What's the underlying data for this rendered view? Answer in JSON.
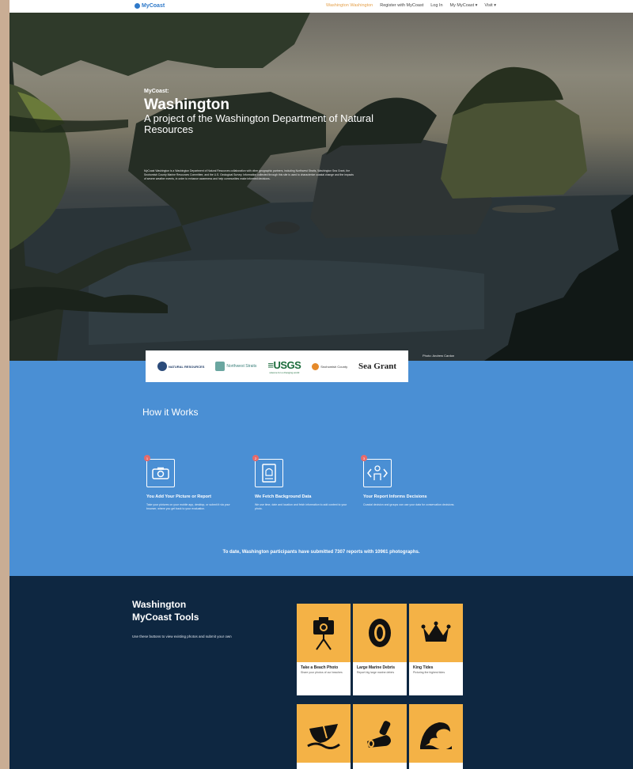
{
  "nav": {
    "brand": "MyCoast",
    "links": [
      "Washington Washington",
      "Register with MyCoast",
      "Log In",
      "My MyCoast ▾",
      "Visit ▾"
    ]
  },
  "hero": {
    "kicker": "MyCoast:",
    "title": "Washington",
    "subtitle": "A project of the Washington Department of Natural Resources",
    "description": "MyCoast Washington is a Washington Department of Natural Resources collaboration with other geographic partners, including Northwest Straits, Washington Sea Grant, the Snohomish County Marine Resources Committee, and the U.S. Geological Survey. Information collected through this site is used to characterize coastal change and the impacts of severe weather events, in order to enhance awareness and help communities make informed decisions.",
    "credit": "Photo: Andrew Cardon"
  },
  "logos": {
    "dnr": "NATURAL RESOURCES",
    "nws": "Northwest Straits",
    "usgs": "≡USGS",
    "usgs_tag": "science for a changing world",
    "snoco": "Snohomish County",
    "seagrant": "Sea Grant"
  },
  "how": {
    "title": "How it Works",
    "steps": [
      {
        "num": "1",
        "icon": "camera-icon",
        "title": "You Add Your Picture or Report",
        "desc": "Take your pictures on your mobile app, desktop, or submit it via your browser, where you get back to your evaluation."
      },
      {
        "num": "2",
        "icon": "document-icon",
        "title": "We Fetch Background Data",
        "desc": "We use time, date and location and fetch information to add context to your photo."
      },
      {
        "num": "3",
        "icon": "person-code-icon",
        "title": "Your Report Informs Decisions",
        "desc": "Coastal decision and groups can use your data for conservation decisions."
      }
    ],
    "stat": "To date, Washington participants have submitted 7307 reports with 10961 photographs."
  },
  "tools": {
    "title_line1": "Washington",
    "title_line2": "MyCoast Tools",
    "desc": "Use these buttons to view existing photos and submit your own",
    "tiles": [
      {
        "icon": "camera-tripod-icon",
        "name": "Take a Beach Photo",
        "sub": "Share your photos of our beaches"
      },
      {
        "icon": "tire-icon",
        "name": "Large Marine Debris",
        "sub": "Report big large marine debris"
      },
      {
        "icon": "crown-icon",
        "name": "King Tides",
        "sub": "Picturing the highest tides"
      },
      {
        "icon": "boat-icon",
        "name": "",
        "sub": ""
      },
      {
        "icon": "debris-icon",
        "name": "",
        "sub": ""
      },
      {
        "icon": "wave-icon",
        "name": "",
        "sub": ""
      }
    ]
  },
  "colors": {
    "blue": "#4a8fd4",
    "navy": "#0e2741",
    "orange": "#f4b246"
  }
}
